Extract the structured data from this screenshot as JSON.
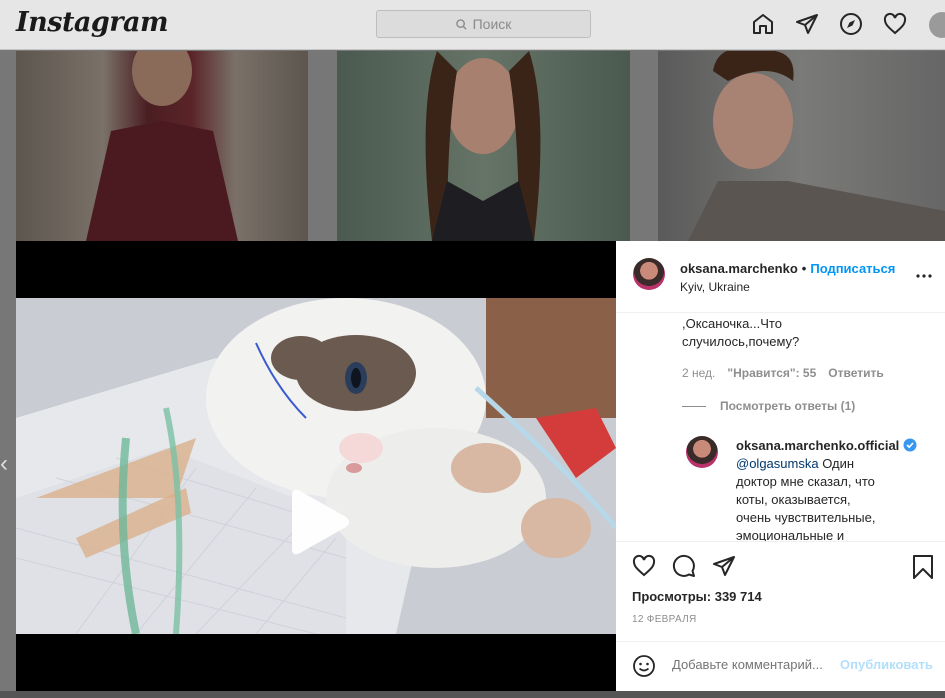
{
  "topbar": {
    "logo": "Instagram",
    "search_placeholder": "Поиск"
  },
  "post": {
    "username": "oksana.marchenko",
    "follow_label": "Подписаться",
    "location": "Kyiv, Ukraine",
    "comment": {
      "line1": ",Оксаночка...Что",
      "line2": "случилось,почему?",
      "age": "2 нед.",
      "likes": "\"Нравится\": 55",
      "reply_label": "Ответить",
      "view_replies": "Посмотреть ответы (1)"
    },
    "reply": {
      "username": "oksana.marchenko.official",
      "mention": "@olgasumska",
      "text_lines": [
        "Один",
        "доктор мне сказал, что",
        "коты, оказывается,",
        "очень чувствительные,",
        "эмоциональные и"
      ]
    },
    "views_label": "Просмотры:",
    "views_count": "339 714",
    "date": "12 ФЕВРАЛЯ",
    "add_comment_placeholder": "Добавьте комментарий...",
    "publish_label": "Опубликовать"
  },
  "colors": {
    "link_blue": "#0095f6",
    "publish_disabled": "#b2dffc",
    "overlay": "#777777"
  }
}
